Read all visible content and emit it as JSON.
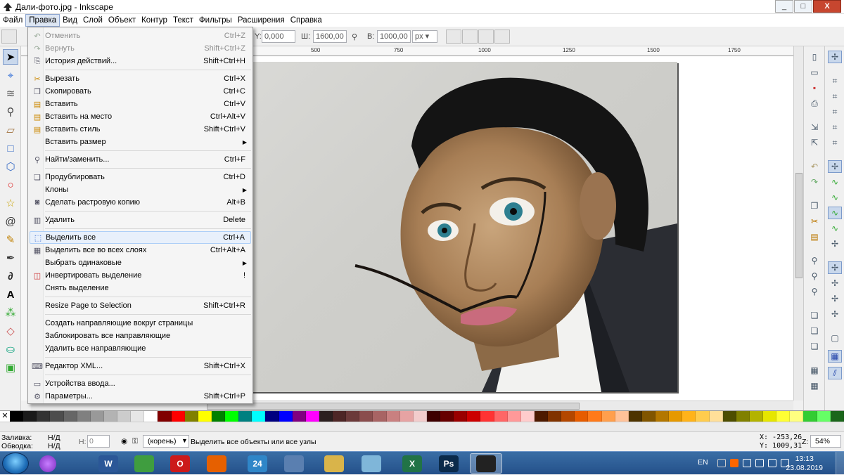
{
  "window": {
    "title": "Дали-фото.jpg - Inkscape",
    "buttons": [
      "_",
      "□",
      "X"
    ]
  },
  "menubar": [
    {
      "label": "Файл"
    },
    {
      "label": "Правка",
      "open": true
    },
    {
      "label": "Вид"
    },
    {
      "label": "Слой"
    },
    {
      "label": "Объект"
    },
    {
      "label": "Контур"
    },
    {
      "label": "Текст"
    },
    {
      "label": "Фильтры"
    },
    {
      "label": "Расширения"
    },
    {
      "label": "Справка"
    }
  ],
  "controls": {
    "y_label": "Y:",
    "y_value": "0,000",
    "w_label": "Ш:",
    "w_value": "1600,00",
    "h_label": "В:",
    "h_value": "1000,00",
    "unit": "px"
  },
  "ruler": [
    "500",
    "750",
    "1000",
    "1250",
    "1500",
    "1750"
  ],
  "edit_menu": [
    {
      "icon": "undo-icon",
      "label": "Отменить",
      "shortcut": "Ctrl+Z",
      "disabled": true
    },
    {
      "icon": "redo-icon",
      "label": "Вернуть",
      "shortcut": "Shift+Ctrl+Z",
      "disabled": true
    },
    {
      "icon": "history-icon",
      "label": "История действий...",
      "shortcut": "Shift+Ctrl+H"
    },
    {
      "sep": true
    },
    {
      "icon": "cut-icon",
      "label": "Вырезать",
      "shortcut": "Ctrl+X"
    },
    {
      "icon": "copy-icon",
      "label": "Скопировать",
      "shortcut": "Ctrl+C"
    },
    {
      "icon": "paste-icon",
      "label": "Вставить",
      "shortcut": "Ctrl+V"
    },
    {
      "icon": "paste-in-place-icon",
      "label": "Вставить на место",
      "shortcut": "Ctrl+Alt+V"
    },
    {
      "icon": "paste-style-icon",
      "label": "Вставить стиль",
      "shortcut": "Shift+Ctrl+V"
    },
    {
      "icon": "",
      "label": "Вставить размер",
      "shortcut": "",
      "submenu": true
    },
    {
      "sep": true
    },
    {
      "icon": "find-icon",
      "label": "Найти/заменить...",
      "shortcut": "Ctrl+F"
    },
    {
      "sep": true
    },
    {
      "icon": "duplicate-icon",
      "label": "Продублировать",
      "shortcut": "Ctrl+D"
    },
    {
      "icon": "",
      "label": "Клоны",
      "shortcut": "",
      "submenu": true
    },
    {
      "icon": "camera-icon",
      "label": "Сделать растровую копию",
      "shortcut": "Alt+B"
    },
    {
      "sep": true
    },
    {
      "icon": "trash-icon",
      "label": "Удалить",
      "shortcut": "Delete"
    },
    {
      "sep": true
    },
    {
      "icon": "select-all-icon",
      "label": "Выделить все",
      "shortcut": "Ctrl+A",
      "highlight": true
    },
    {
      "icon": "select-all-layers-icon",
      "label": "Выделить все во всех слоях",
      "shortcut": "Ctrl+Alt+A"
    },
    {
      "icon": "",
      "label": "Выбрать одинаковые",
      "shortcut": "",
      "submenu": true
    },
    {
      "icon": "invert-selection-icon",
      "label": "Инвертировать выделение",
      "shortcut": "!"
    },
    {
      "icon": "",
      "label": "Снять выделение",
      "shortcut": ""
    },
    {
      "sep": true
    },
    {
      "icon": "",
      "label": "Resize Page to Selection",
      "shortcut": "Shift+Ctrl+R"
    },
    {
      "sep": true
    },
    {
      "icon": "",
      "label": "Создать направляющие вокруг страницы",
      "shortcut": ""
    },
    {
      "icon": "",
      "label": "Заблокировать все направляющие",
      "shortcut": ""
    },
    {
      "icon": "",
      "label": "Удалить все направляющие",
      "shortcut": ""
    },
    {
      "sep": true
    },
    {
      "icon": "xml-editor-icon",
      "label": "Редактор XML...",
      "shortcut": "Shift+Ctrl+X"
    },
    {
      "sep": true
    },
    {
      "icon": "input-devices-icon",
      "label": "Устройства ввода...",
      "shortcut": ""
    },
    {
      "icon": "preferences-icon",
      "label": "Параметры...",
      "shortcut": "Shift+Ctrl+P"
    }
  ],
  "status": {
    "fill_label": "Заливка:",
    "fill_value": "Н/Д",
    "stroke_label": "Обводка:",
    "stroke_value": "Н/Д",
    "h_label": "Н:",
    "h_value": "0",
    "layer": "(корень)",
    "message": "Выделить все объекты или все узлы",
    "x_coord": "X: -253,26",
    "y_coord": "Y: 1009,31",
    "zoom_label": "Z:",
    "zoom_value": "54%"
  },
  "taskbar": {
    "apps": [
      {
        "name": "word",
        "label": "W",
        "color": "#2b5797"
      },
      {
        "name": "chrome",
        "label": "",
        "color": "#3f9d3f"
      },
      {
        "name": "opera",
        "label": "O",
        "color": "#cc1a1a"
      },
      {
        "name": "firefox",
        "label": "",
        "color": "#e66000"
      },
      {
        "name": "app-24",
        "label": "24",
        "color": "#2f86c8"
      },
      {
        "name": "computer",
        "label": "",
        "color": "#5a7fb0"
      },
      {
        "name": "explorer",
        "label": "",
        "color": "#d9b44a"
      },
      {
        "name": "notes",
        "label": "",
        "color": "#7fb6d9"
      },
      {
        "name": "excel",
        "label": "X",
        "color": "#217346"
      },
      {
        "name": "photoshop",
        "label": "Ps",
        "color": "#0a2a4a"
      },
      {
        "name": "inkscape",
        "label": "",
        "color": "#222222",
        "active": true
      }
    ],
    "lang": "EN",
    "time": "13:13",
    "date": "23.08.2019"
  },
  "palette": [
    "#000000",
    "#1a1a1a",
    "#333333",
    "#4d4d4d",
    "#666666",
    "#808080",
    "#999999",
    "#b3b3b3",
    "#cccccc",
    "#e6e6e6",
    "#ffffff",
    "#800000",
    "#ff0000",
    "#808000",
    "#ffff00",
    "#008000",
    "#00ff00",
    "#008080",
    "#00ffff",
    "#000080",
    "#0000ff",
    "#800080",
    "#ff00ff",
    "#2b1f1f",
    "#4d2626",
    "#6b3a3a",
    "#8a4d4d",
    "#a86464",
    "#c98080",
    "#e6a3a3",
    "#f2cccc",
    "#3d0000",
    "#660000",
    "#990000",
    "#cc0000",
    "#ff3333",
    "#ff6666",
    "#ff9999",
    "#ffcccc",
    "#4d1a00",
    "#803300",
    "#b34700",
    "#e65c00",
    "#ff7a1a",
    "#ff9f4d",
    "#ffc299",
    "#4d3300",
    "#805500",
    "#b37700",
    "#e69900",
    "#ffb31a",
    "#ffcc4d",
    "#ffdf99",
    "#4d4d00",
    "#808000",
    "#b3b300",
    "#e6e600",
    "#ffff33",
    "#ffff80",
    "#33cc33",
    "#66ff66",
    "#1a661a"
  ]
}
